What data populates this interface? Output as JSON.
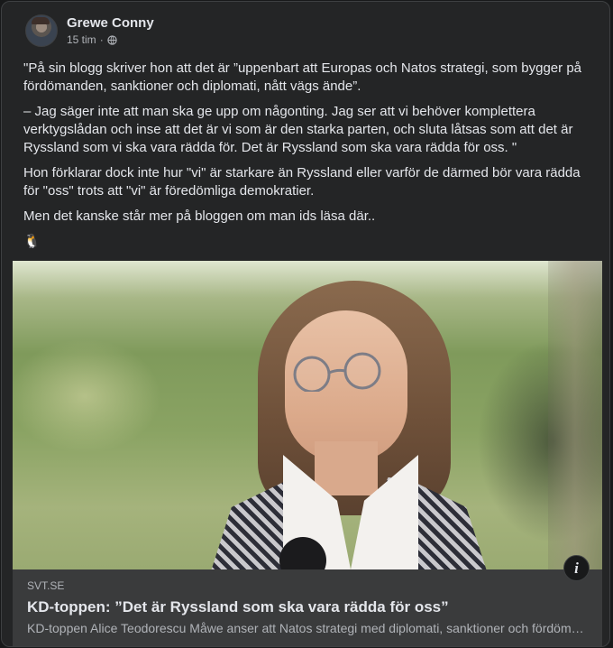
{
  "post": {
    "author": "Grewe Conny",
    "time": "15 tim",
    "separator": "·",
    "privacy_icon": "globe-icon",
    "paragraphs": [
      "\"På sin blogg skriver hon att det är ”uppenbart att Europas och Natos strategi, som bygger på fördömanden, sanktioner och diplomati, nått vägs ände”.",
      "– Jag säger inte att man ska ge upp om någonting. Jag ser att vi behöver komplettera verktygslådan och inse att det är vi som är den starka parten, och sluta låtsas som att det är Ryssland som vi ska vara rädda för. Det är Ryssland som ska vara rädda för oss. \"",
      "Hon förklarar dock inte hur \"vi\" är starkare än Ryssland eller varför de därmed bör vara rädda för \"oss\" trots att \"vi\" är föredömliga demokratier.",
      "Men det kanske står mer på bloggen om man ids läsa där.."
    ],
    "emoji": "🐧"
  },
  "link": {
    "domain": "SVT.SE",
    "title": "KD-toppen: ”Det är Ryssland som ska vara rädda för oss”",
    "description": "KD-toppen Alice Teodorescu Måwe anser att Natos strategi med diplomati, sanktioner och fördömanden nått vägs ände.",
    "info_label": "i"
  }
}
